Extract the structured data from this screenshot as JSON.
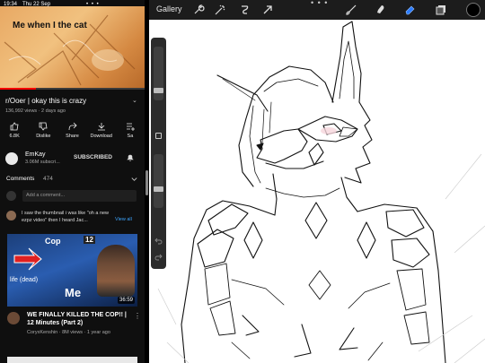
{
  "status_bar": {
    "time": "19:34",
    "date": "Thu 22 Sep",
    "dots": "• • •"
  },
  "youtube": {
    "player": {
      "caption": "Me when I the cat",
      "progress": 0.25
    },
    "video": {
      "title": "r/Ooer | okay this is crazy",
      "meta": "136,992 views · 2 days ago",
      "more_icon": "chevron-down-icon"
    },
    "actions": [
      {
        "label": "6.8K",
        "icon": "thumbs-up-icon"
      },
      {
        "label": "Dislike",
        "icon": "thumbs-down-icon"
      },
      {
        "label": "Share",
        "icon": "share-icon"
      },
      {
        "label": "Download",
        "icon": "download-icon"
      },
      {
        "label": "Sa",
        "icon": "save-icon"
      }
    ],
    "channel": {
      "name": "EmKay",
      "subs": "3.06M subscri...",
      "subscribed_label": "SUBSCRIBED",
      "bell_icon": "bell-icon"
    },
    "comments": {
      "title": "Comments",
      "count": "474",
      "placeholder": "Add a comment...",
      "top_comment": "I saw the thumbnail i was like \"oh a new ezpz video\" then I heard Jac...",
      "view_all": "View all"
    },
    "recommended": {
      "thumb_text_cop": "Cop",
      "thumb_text_num": "12",
      "thumb_text_life": "life (dead)",
      "thumb_text_me": "Me",
      "duration": "36:59",
      "title": "WE FINALLY KILLED THE COP!! | 12 Minutes (Part 2)",
      "meta": "CoryxKenshin · 8M views · 1 year ago",
      "more": "⋮"
    }
  },
  "procreate": {
    "gallery_label": "Gallery",
    "top_icons": [
      "wrench-icon",
      "magic-wand-icon",
      "selection-icon",
      "transform-arrow-icon",
      "brush-icon",
      "smudge-icon",
      "eraser-icon",
      "layers-icon"
    ],
    "dots": "• • •",
    "active_tool": "eraser-icon",
    "accent": "#2b7cff",
    "current_color": "#000000"
  }
}
